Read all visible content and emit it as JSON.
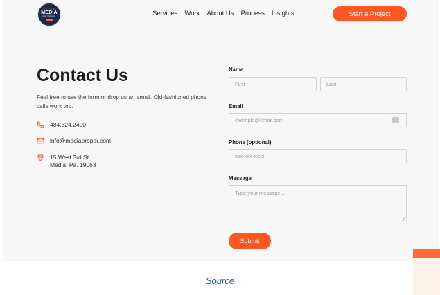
{
  "brand": {
    "logo_main": "MEDIA",
    "logo_sub": "PROPER"
  },
  "nav": {
    "items": [
      "Services",
      "Work",
      "About Us",
      "Process",
      "Insights"
    ],
    "cta": "Start a Project"
  },
  "contact": {
    "title": "Contact Us",
    "intro": "Feel free to use the form or drop us an email. Old-fashioned phone calls work too.",
    "phone": "484.324.2400",
    "email": "info@mediaproper.com",
    "address_line1": "15 West 3rd St.",
    "address_line2": "Media, Pa. 19063"
  },
  "form": {
    "name_label": "Name",
    "first_placeholder": "First",
    "last_placeholder": "Last",
    "email_label": "Email",
    "email_placeholder": "example@email.com",
    "phone_label": "Phone (optional)",
    "phone_placeholder": "xxx-xxx-xxxx",
    "message_label": "Message",
    "message_placeholder": "Type your message ...",
    "submit": "Submit"
  },
  "caption": {
    "source": "Source"
  },
  "colors": {
    "accent": "#ff5722",
    "logo_navy": "#1d2a4a",
    "link": "#1f5b9e"
  }
}
